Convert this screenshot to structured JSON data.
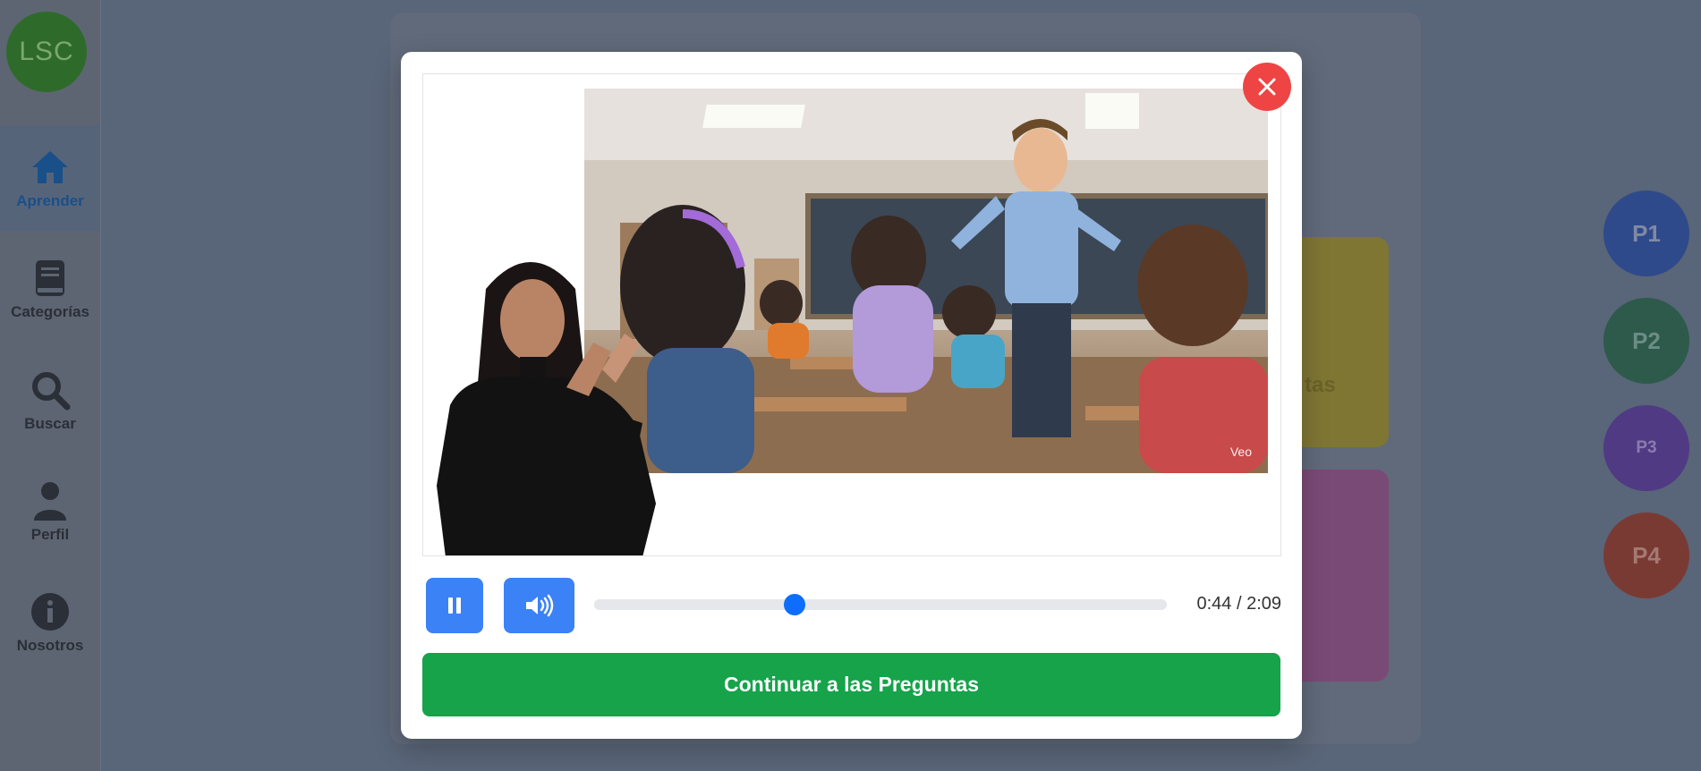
{
  "sidebar": {
    "logo": "LSC",
    "items": [
      {
        "label": "Aprender",
        "icon": "home-icon"
      },
      {
        "label": "Categorías",
        "icon": "book-icon"
      },
      {
        "label": "Buscar",
        "icon": "search-icon"
      },
      {
        "label": "Perfil",
        "icon": "user-icon"
      },
      {
        "label": "Nosotros",
        "icon": "info-icon"
      }
    ]
  },
  "background": {
    "category_partial_text": "tas",
    "question_buttons": [
      "P1",
      "P2",
      "P3",
      "P4"
    ]
  },
  "modal": {
    "video": {
      "watermark": "Veo",
      "progress": 0.35
    },
    "time": "0:44 / 2:09",
    "continue_label": "Continuar a las Preguntas"
  },
  "colors": {
    "primary_blue": "#3b82f6",
    "slider_blue": "#0d6efd",
    "close_red": "#ef4444",
    "continue_green": "#16a34a"
  }
}
